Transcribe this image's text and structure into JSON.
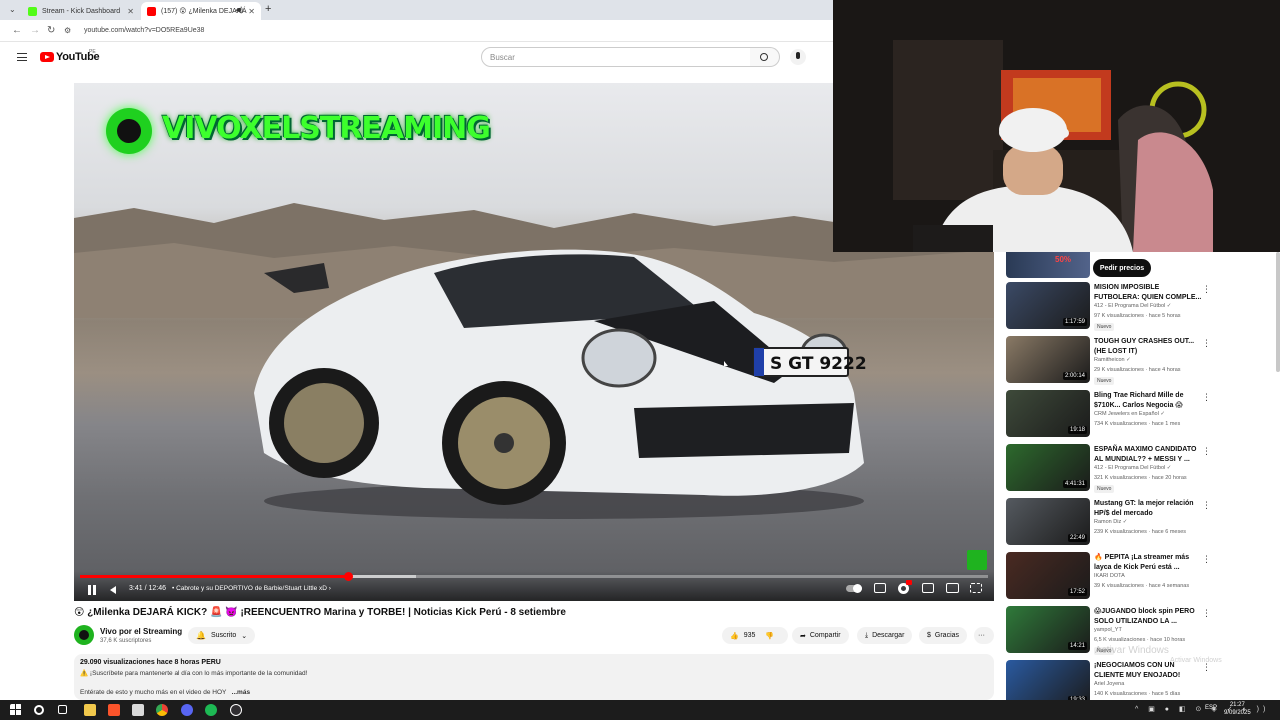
{
  "browser": {
    "tabs": [
      {
        "label": "Stream - Kick Dashboard",
        "favicon_color": "#53fc18"
      },
      {
        "label": "(157) 😲 ¿Milenka DEJARÁ",
        "favicon_color": "#ff0000"
      }
    ],
    "new_tab_label": "+",
    "url": "youtube.com/watch?v=DO5REa9Ue38"
  },
  "youtube": {
    "logo_text": "YouTube",
    "logo_sup": "PE",
    "search_placeholder": "Buscar"
  },
  "player": {
    "watermark_text": "VIVOXELSTREAMING",
    "plate_text": "S GT 9222",
    "time": "3:41 / 12:46",
    "chapter": "• Cabrote y su DEPORTIVO de Barbie/Stuart Little xD  ›",
    "progress": 0.295,
    "buffered": 0.37
  },
  "video": {
    "title": "😲 ¿Milenka DEJARÁ KICK? 🚨 👿 ¡REENCUENTRO Marina y TORBE! | Noticias Kick Perú - 8 setiembre",
    "channel_name": "Vivo por el Streaming",
    "channel_subs": "37,6 K suscriptores",
    "subscribe_label": "Suscrito",
    "likes": "935",
    "share_label": "Compartir",
    "download_label": "Descargar",
    "thanks_label": "Gracias",
    "more_label": "···",
    "desc_meta": "29.090 visualizaciones  hace 8 horas  PERU",
    "desc_line1": "⚠️ ¡Suscríbete para mantenerte al día con lo más importante de la comunidad!",
    "desc_line2": "Entérate de esto y mucho más en el video de HOY",
    "desc_more": "...más"
  },
  "sidebar": {
    "ad_thumb_text": "50%",
    "ad_button": "Pedir precios",
    "recs": [
      {
        "title": "MISION IMPOSIBLE FUTBOLERA: QUIEN COMPLE...",
        "channel": "412 - El Programa Del Fútbol ✓",
        "meta": "97 K visualizaciones · hace 5 horas",
        "badge": "Nuevo",
        "duration": "1:17:59",
        "thumb": "#3b4a66"
      },
      {
        "title": "TOUGH GUY CRASHES OUT... (HE LOST IT)",
        "channel": "Ramitheicon ✓",
        "meta": "29 K visualizaciones · hace 4 horas",
        "badge": "Nuevo",
        "duration": "2:00:14",
        "thumb": "#8a7a66"
      },
      {
        "title": "Bling Trae Richard Mille de $710K... Carlos Negocia 😱",
        "channel": "CRM Jewelers en Español ✓",
        "meta": "734 K visualizaciones · hace 1 mes",
        "badge": "",
        "duration": "19:18",
        "thumb": "#3e4a3a"
      },
      {
        "title": "ESPAÑA MAXIMO CANDIDATO AL MUNDIAL?? + MESSI Y ...",
        "channel": "412 - El Programa Del Fútbol ✓",
        "meta": "321 K visualizaciones · hace 20 horas",
        "badge": "Nuevo",
        "duration": "4:41:31",
        "thumb": "#2d6a2d"
      },
      {
        "title": "Mustang GT: la mejor relación HP/$ del mercado",
        "channel": "Ramon Diz ✓",
        "meta": "239 K visualizaciones · hace 6 meses",
        "badge": "",
        "duration": "22:49",
        "thumb": "#555a60"
      },
      {
        "title": "🔥 PEPITA ¡La streamer más layca de Kick Perú está ...",
        "channel": "IKARI DOTA",
        "meta": "39 K visualizaciones · hace 4 semanas",
        "badge": "",
        "duration": "17:52",
        "thumb": "#4a2a22"
      },
      {
        "title": "😱JUGANDO block spin PERO SOLO UTILIZANDO LA ...",
        "channel": "yampol_YT",
        "meta": "6,5 K visualizaciones · hace 10 horas",
        "badge": "Nuevo",
        "duration": "14:21",
        "thumb": "#2f7a3a"
      },
      {
        "title": "¡NEGOCIAMOS CON UN CLIENTE MUY ENOJADO!",
        "channel": "Ariel Joyena",
        "meta": "140 K visualizaciones · hace 5 días",
        "badge": "Nuevo",
        "duration": "19:33",
        "thumb": "#2a5aa0"
      }
    ]
  },
  "overlay": {
    "activate_windows": "Activar Windows",
    "activate_windows_sub": "Activar Windows"
  },
  "taskbar": {
    "lang": "ESP",
    "time": "21:27",
    "date": "9/09/2025"
  }
}
